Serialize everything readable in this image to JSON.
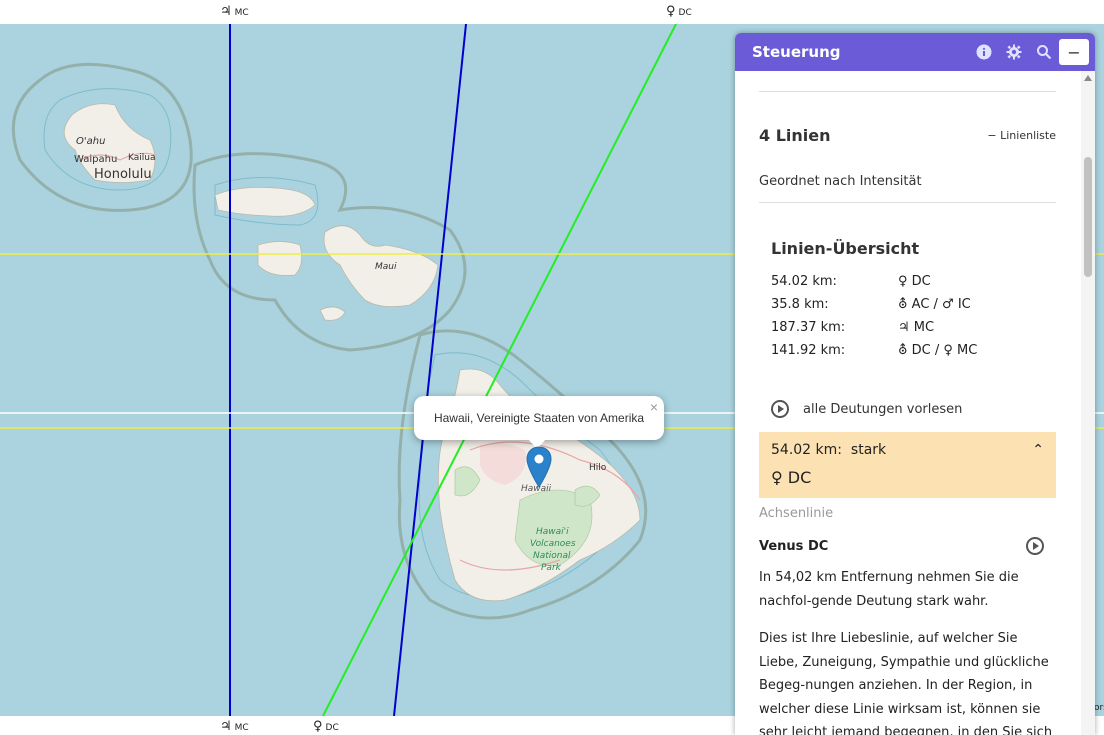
{
  "map": {
    "top_labels": [
      {
        "planet": "♃",
        "angle": "MC"
      },
      {
        "planet": "♀",
        "angle": "DC"
      }
    ],
    "bottom_labels": [
      {
        "planet": "♃",
        "angle": "MC"
      },
      {
        "planet": "♀",
        "angle": "DC"
      }
    ],
    "place_labels": {
      "oahu": "O'ahu",
      "waipahu": "Waipahu",
      "kailua": "Kailua",
      "honolulu": "Honolulu",
      "maui": "Maui",
      "hilo": "Hilo",
      "hawaii": "Hawaii",
      "park1": "Hawai'i",
      "park2": "Volcanoes",
      "park3": "National",
      "park4": "Park"
    },
    "popup_text": "Hawaii, Vereinigte Staaten von Amerika",
    "popup_close": "×",
    "colors": {
      "water": "#aad3df",
      "land": "#f2efe9",
      "jupiter_line": "#0000cc",
      "venus_line": "#22ee22",
      "parallel": "#eeee44"
    }
  },
  "panel": {
    "title": "Steuerung",
    "icons": [
      "info-icon",
      "gear-icon",
      "search-icon"
    ],
    "minimize_label": "−",
    "lines_title": "4 Linien",
    "lines_list_label": "−  Linienliste",
    "sort_label": "Geordnet nach Intensität",
    "overview_title": "Linien-Übersicht",
    "overview_rows": [
      {
        "km": "54.02 km:",
        "desc": "♀  DC"
      },
      {
        "km": "35.8 km:",
        "desc": "⛢  AC / ♂  IC"
      },
      {
        "km": "187.37 km:",
        "desc": "♃  MC"
      },
      {
        "km": "141.92 km:",
        "desc": "⛢  DC / ♀  MC"
      }
    ],
    "read_all_label": "alle Deutungen vorlesen",
    "highlight": {
      "km": "54.02 km:",
      "strength": "stark",
      "line": "♀  DC",
      "collapse": "⌃"
    },
    "axis_label": "Achsenlinie",
    "venus_title": "Venus DC",
    "para1": "In 54,02 km Entfernung nehmen Sie die nachfol-gende Deutung stark wahr.",
    "para2": "Dies ist Ihre Liebeslinie, auf welcher Sie Liebe, Zuneigung, Sympathie und glückliche Begeg-nungen anziehen. In der Region, in welcher diese Linie wirksam ist, können sie sehr leicht jemand begegnen, in den Sie sich glücklich verlieben.",
    "accent": "#6b5bd6",
    "highlight_color": "#fce2b2"
  },
  "attribution": "ors"
}
